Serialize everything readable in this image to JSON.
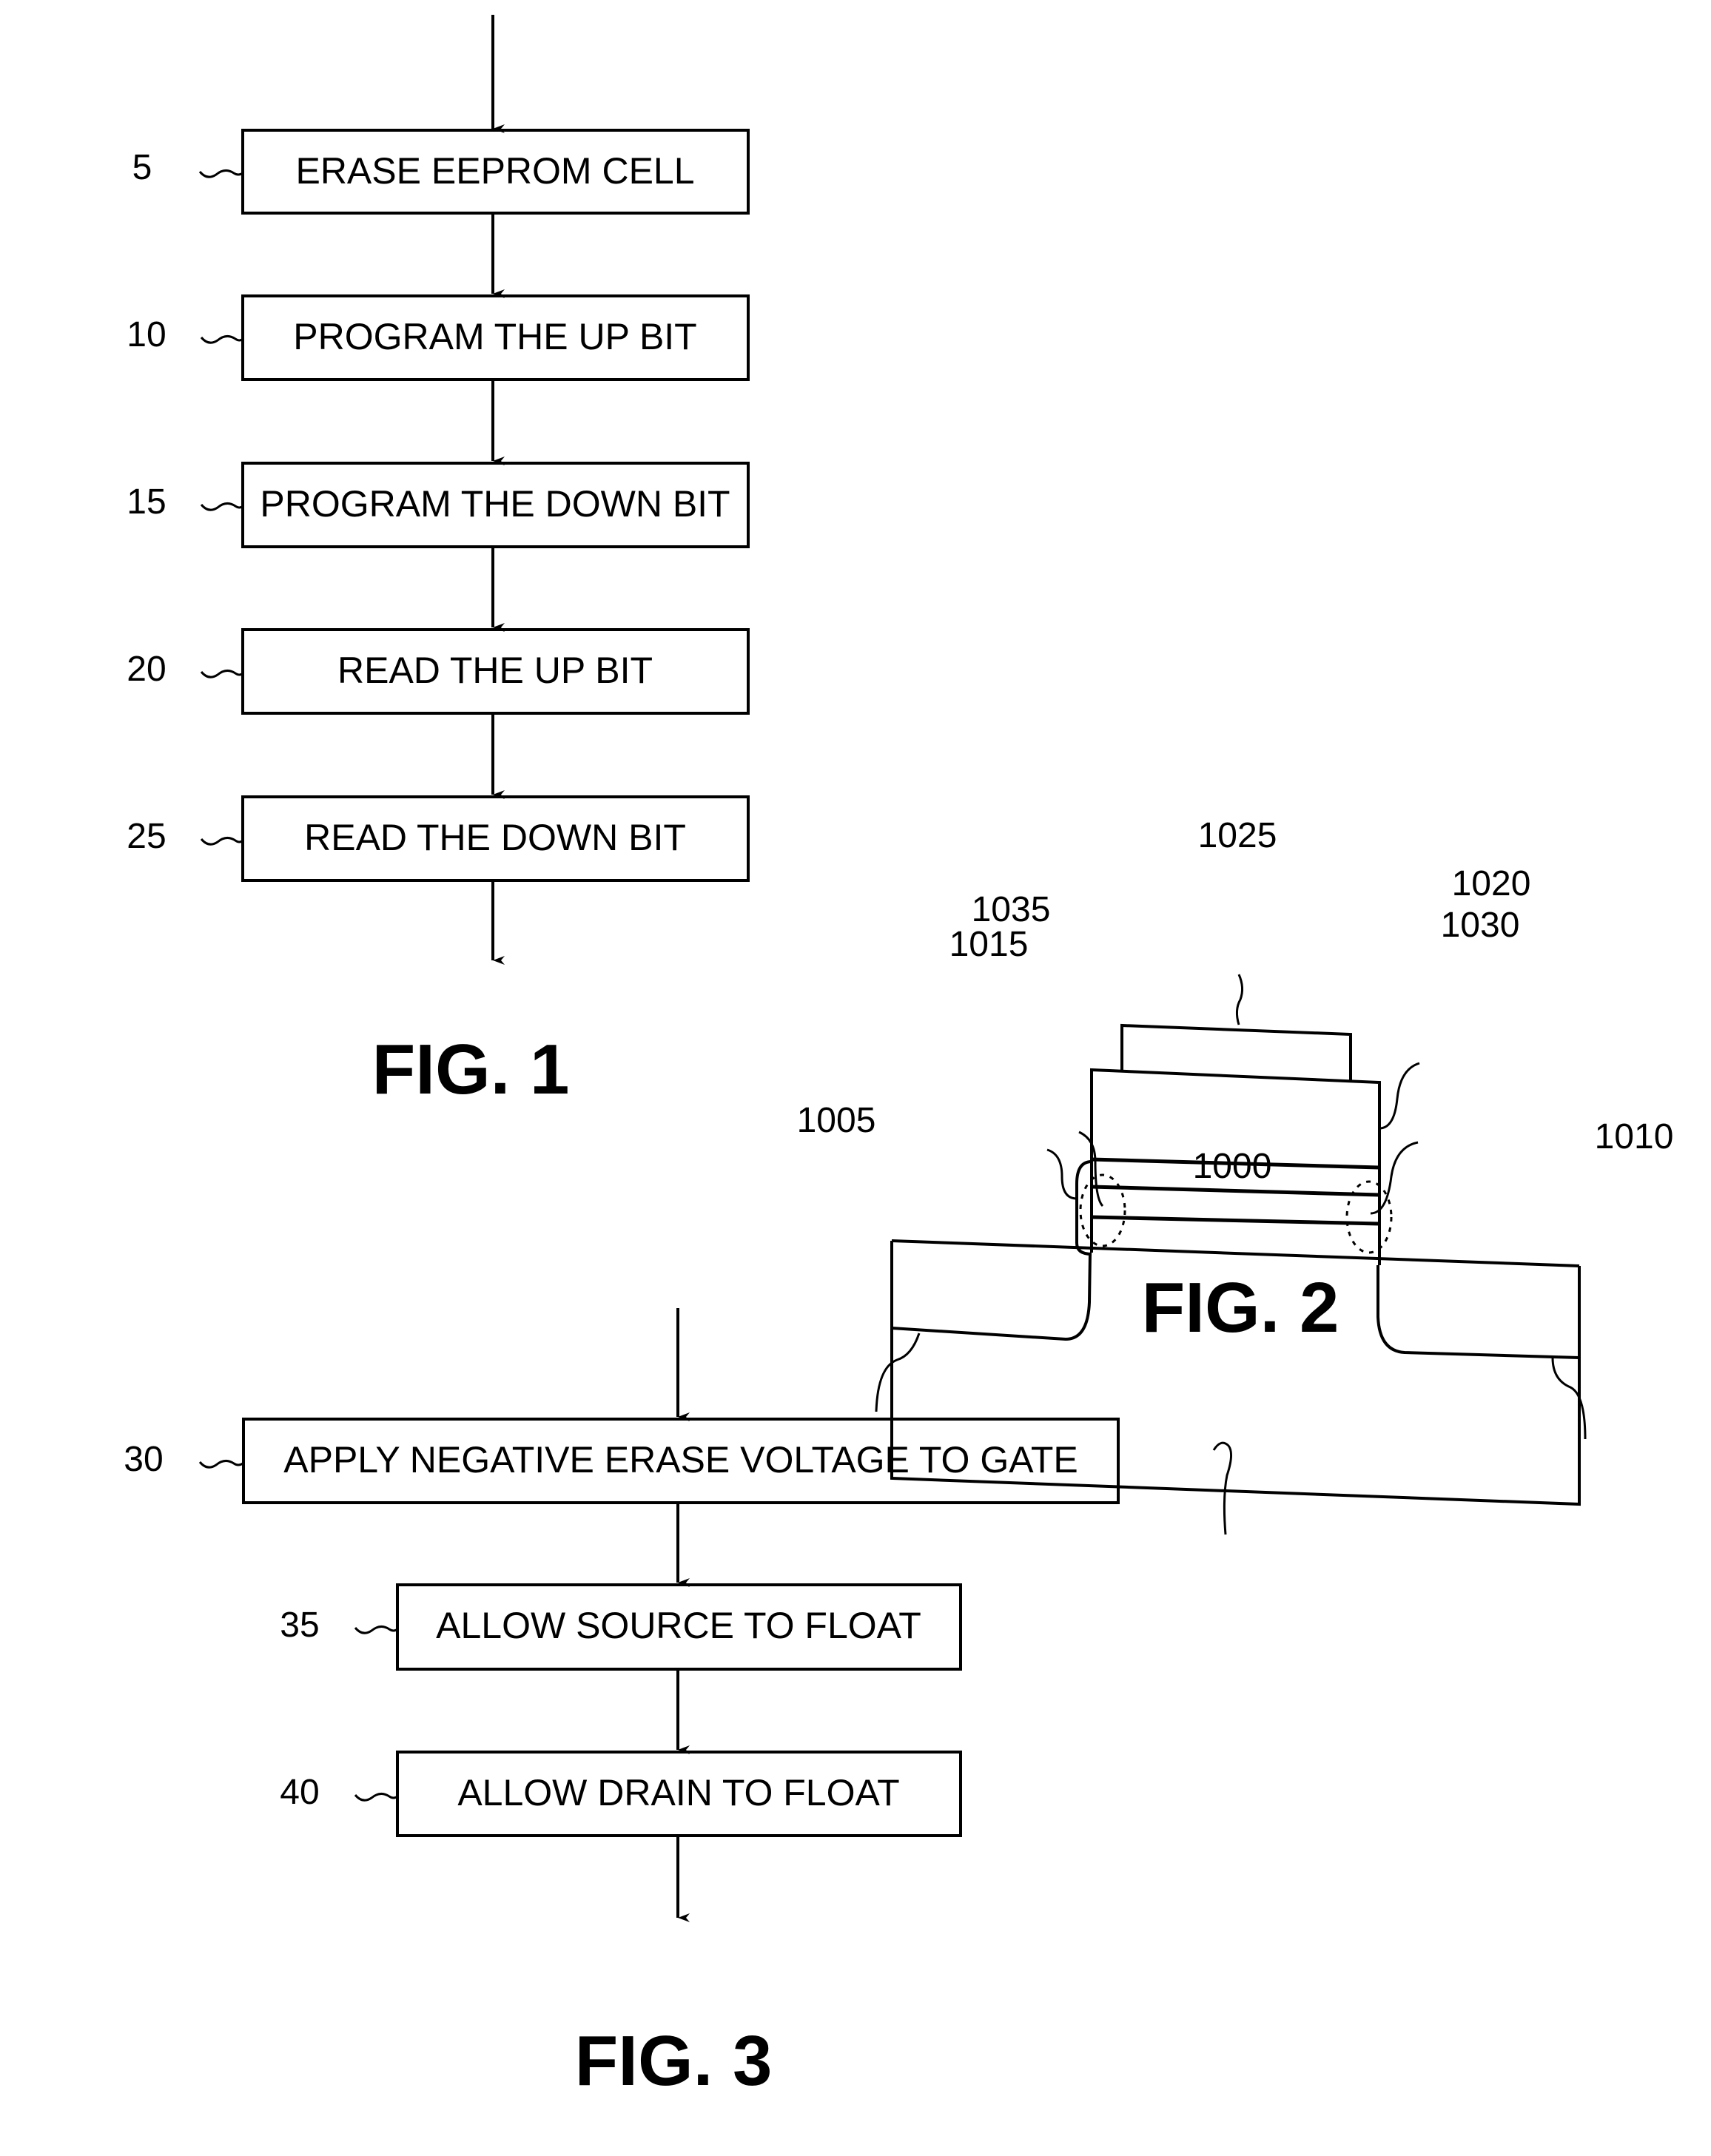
{
  "fig1": {
    "label": "FIG. 1",
    "steps": [
      {
        "ref": "5",
        "text": "ERASE EEPROM CELL"
      },
      {
        "ref": "10",
        "text": "PROGRAM THE UP BIT"
      },
      {
        "ref": "15",
        "text": "PROGRAM THE DOWN BIT"
      },
      {
        "ref": "20",
        "text": "READ THE UP BIT"
      },
      {
        "ref": "25",
        "text": "READ THE DOWN BIT"
      }
    ]
  },
  "fig2": {
    "label": "FIG. 2",
    "refs": {
      "substrate": "1000",
      "source": "1005",
      "drain": "1010",
      "left_region": "1015",
      "gate": "1020",
      "top_gate": "1025",
      "right_region": "1030",
      "left_charge": "1035"
    }
  },
  "fig3": {
    "label": "FIG. 3",
    "steps": [
      {
        "ref": "30",
        "text": "APPLY NEGATIVE ERASE VOLTAGE TO GATE"
      },
      {
        "ref": "35",
        "text": "ALLOW SOURCE TO FLOAT"
      },
      {
        "ref": "40",
        "text": "ALLOW DRAIN TO FLOAT"
      }
    ]
  }
}
